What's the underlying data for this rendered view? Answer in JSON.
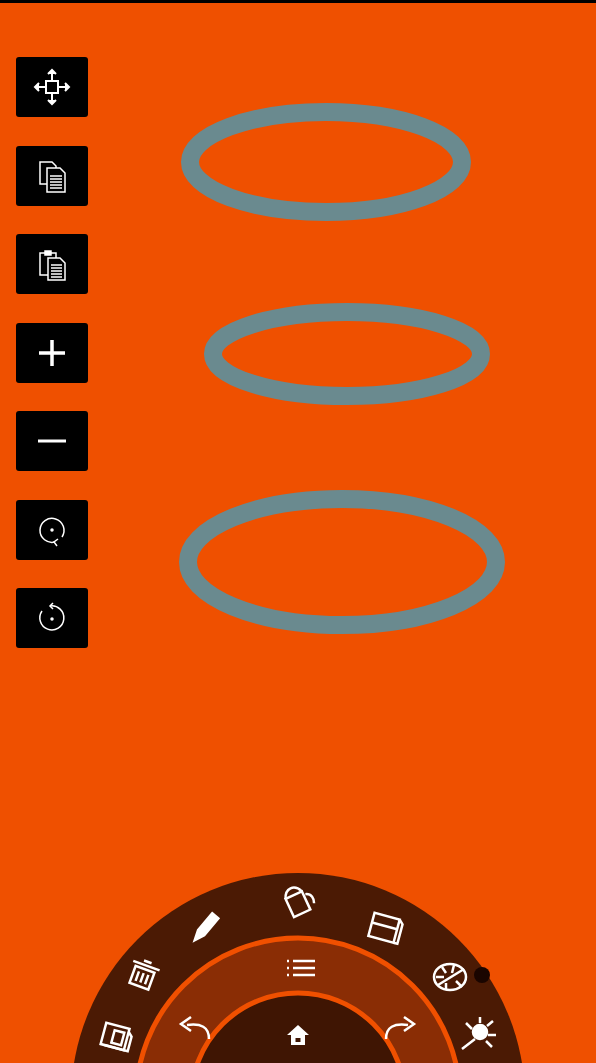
{
  "toolbar": [
    {
      "kind": "move"
    },
    {
      "kind": "copy"
    },
    {
      "kind": "paste"
    },
    {
      "kind": "zoom_in"
    },
    {
      "kind": "zoom_out"
    },
    {
      "kind": "rotate_cw"
    },
    {
      "kind": "rotate_ccw"
    }
  ],
  "canvas": {
    "shapes": [
      {
        "kind": "ellipse"
      },
      {
        "kind": "ellipse"
      },
      {
        "kind": "ellipse"
      }
    ]
  },
  "radial_menu": {
    "outer": [
      {
        "kind": "document"
      },
      {
        "kind": "trash"
      },
      {
        "kind": "pencil"
      },
      {
        "kind": "bucket"
      },
      {
        "kind": "eraser"
      },
      {
        "kind": "palette"
      },
      {
        "kind": "light"
      }
    ],
    "middle": [
      {
        "kind": "undo"
      },
      {
        "kind": "list"
      },
      {
        "kind": "redo"
      }
    ],
    "center": {
      "kind": "home"
    }
  }
}
